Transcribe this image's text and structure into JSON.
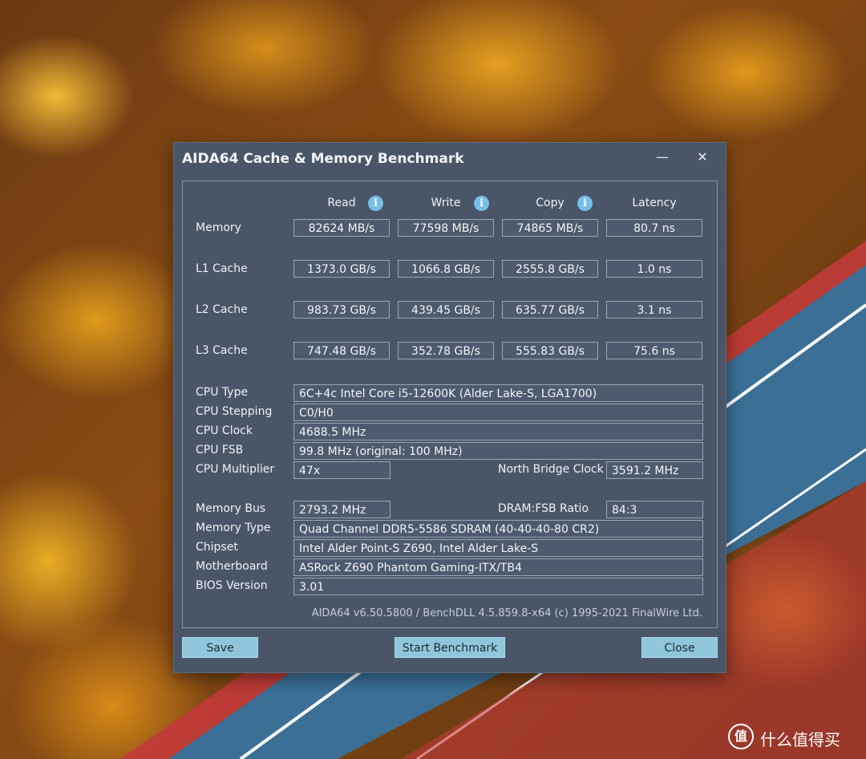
{
  "window": {
    "title": "AIDA64 Cache & Memory Benchmark",
    "minimize": "—",
    "close": "✕"
  },
  "headers": {
    "read": "Read",
    "write": "Write",
    "copy": "Copy",
    "latency": "Latency",
    "info_glyph": "i"
  },
  "rows": [
    {
      "label": "Memory",
      "read": "82624 MB/s",
      "write": "77598 MB/s",
      "copy": "74865 MB/s",
      "latency": "80.7 ns"
    },
    {
      "label": "L1 Cache",
      "read": "1373.0 GB/s",
      "write": "1066.8 GB/s",
      "copy": "2555.8 GB/s",
      "latency": "1.0 ns"
    },
    {
      "label": "L2 Cache",
      "read": "983.73 GB/s",
      "write": "439.45 GB/s",
      "copy": "635.77 GB/s",
      "latency": "3.1 ns"
    },
    {
      "label": "L3 Cache",
      "read": "747.48 GB/s",
      "write": "352.78 GB/s",
      "copy": "555.83 GB/s",
      "latency": "75.6 ns"
    }
  ],
  "cpu": {
    "type_label": "CPU Type",
    "type": "6C+4c Intel Core i5-12600K  (Alder Lake-S, LGA1700)",
    "stepping_label": "CPU Stepping",
    "stepping": "C0/H0",
    "clock_label": "CPU Clock",
    "clock": "4688.5 MHz",
    "fsb_label": "CPU FSB",
    "fsb": "99.8 MHz  (original: 100 MHz)",
    "multiplier_label": "CPU Multiplier",
    "multiplier": "47x",
    "nb_clock_label": "North Bridge Clock",
    "nb_clock": "3591.2 MHz"
  },
  "memory": {
    "bus_label": "Memory Bus",
    "bus": "2793.2 MHz",
    "ratio_label": "DRAM:FSB Ratio",
    "ratio": "84:3",
    "type_label": "Memory Type",
    "type": "Quad Channel DDR5-5586 SDRAM  (40-40-40-80 CR2)",
    "chipset_label": "Chipset",
    "chipset": "Intel Alder Point-S Z690, Intel Alder Lake-S",
    "motherboard_label": "Motherboard",
    "motherboard": "ASRock Z690 Phantom Gaming-ITX/TB4",
    "bios_label": "BIOS Version",
    "bios": "3.01"
  },
  "footer": "AIDA64 v6.50.5800 / BenchDLL 4.5.859.8-x64  (c) 1995-2021 FinalWire Ltd.",
  "buttons": {
    "save": "Save",
    "start": "Start Benchmark",
    "close": "Close"
  },
  "watermark": {
    "logo": "值",
    "text": "什么值得买"
  }
}
